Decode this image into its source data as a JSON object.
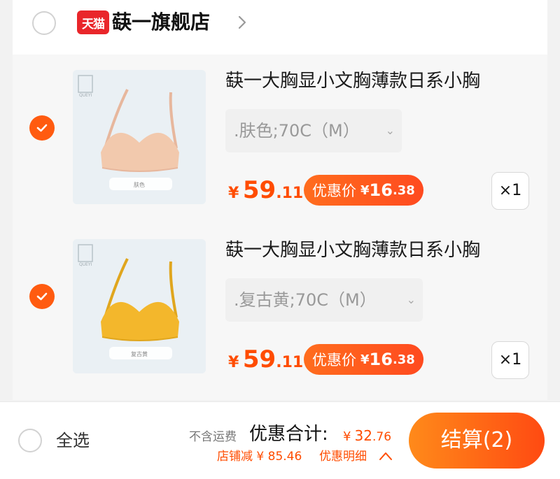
{
  "store": {
    "badge_text": "天猫",
    "name": "蒛一旗舰店"
  },
  "products": [
    {
      "title": "蒛一大胸显小文胸薄款日系小胸",
      "sku": ".肤色;70C（M）",
      "price": {
        "currency": "¥",
        "integer": "59",
        "decimal": ".11"
      },
      "promo": {
        "label": "优惠价",
        "currency": "¥",
        "integer": "16",
        "decimal": ".38"
      },
      "quantity": "×1",
      "checked": true,
      "bra_color": "#f2c9ad",
      "tag_text": "肤色"
    },
    {
      "title": "蒛一大胸显小文胸薄款日系小胸",
      "sku": ".复古黄;70C（M）",
      "price": {
        "currency": "¥",
        "integer": "59",
        "decimal": ".11"
      },
      "promo": {
        "label": "优惠价",
        "currency": "¥",
        "integer": "16",
        "decimal": ".38"
      },
      "quantity": "×1",
      "checked": true,
      "bra_color": "#f3b72c",
      "tag_text": "复古黄"
    }
  ],
  "bottom_bar": {
    "select_all_label": "全选",
    "no_shipping": "不含运费",
    "total_label": "优惠合计:",
    "total": {
      "currency": "¥",
      "integer": "32",
      "decimal": ".76"
    },
    "store_discount": "店铺减 ¥ 85.46",
    "details_label": "优惠明细",
    "checkout_label": "结算(2)"
  },
  "colors": {
    "accent": "#ff5b10",
    "price": "#ff4c00",
    "tmall_red": "#e9262a"
  }
}
